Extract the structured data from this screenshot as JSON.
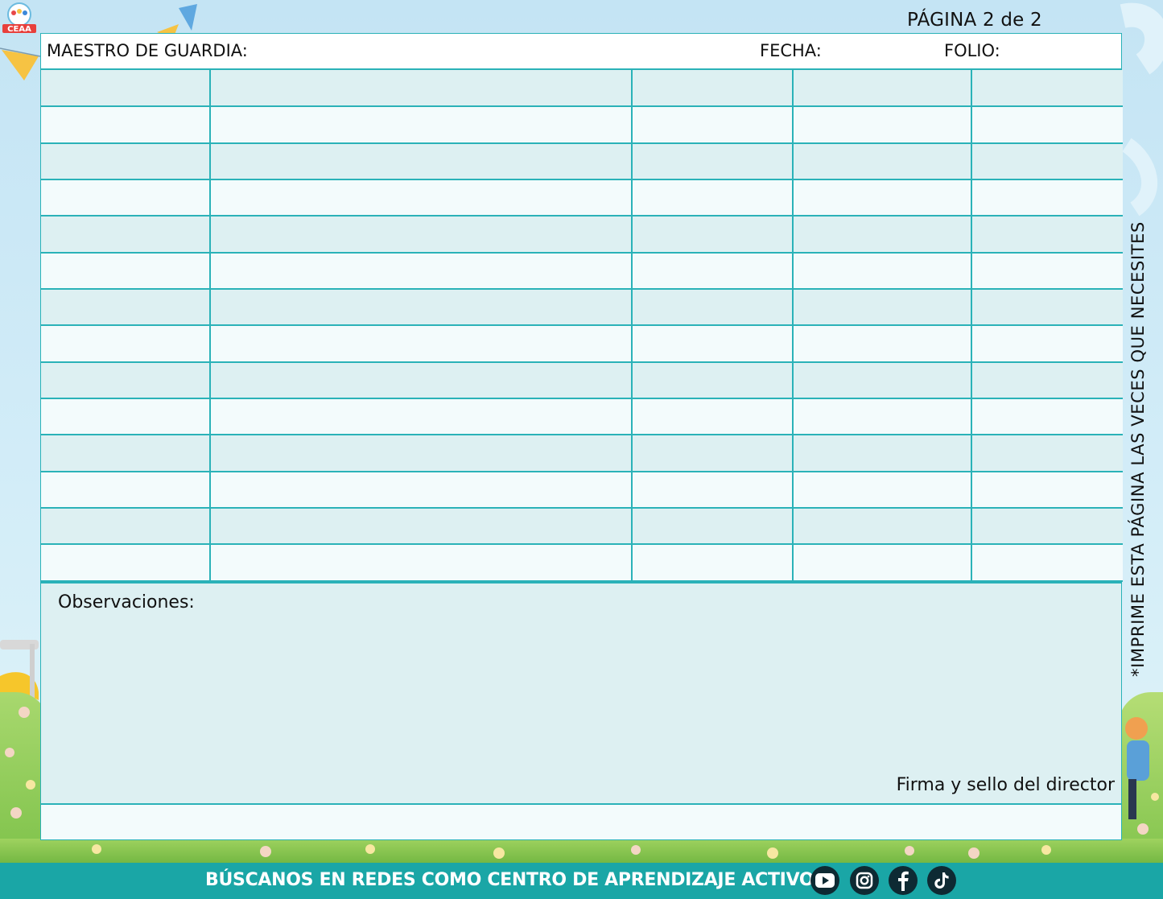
{
  "page": {
    "number_label": "PÁGINA 2 de 2"
  },
  "header": {
    "teacher_label": "MAESTRO DE GUARDIA:",
    "date_label": "FECHA:",
    "folio_label": "FOLIO:"
  },
  "table": {
    "row_count": 14,
    "column_count": 5
  },
  "observations": {
    "label": "Observaciones:",
    "signature_label": "Firma y sello del director"
  },
  "side_note": "*IMPRIME ESTA PÁGINA LAS VECES QUE NECESITES",
  "footer": {
    "text": "BÚSCANOS EN REDES COMO CENTRO DE APRENDIZAJE ACTIVO",
    "social": [
      "youtube-icon",
      "instagram-icon",
      "facebook-icon",
      "tiktok-icon"
    ]
  },
  "logo": {
    "text": "CEAA"
  },
  "colors": {
    "accent": "#2ab2b8",
    "row_alt": "#ddf0f2",
    "row_light": "#f3fbfc",
    "footer_bar": "#1aa6a6"
  }
}
